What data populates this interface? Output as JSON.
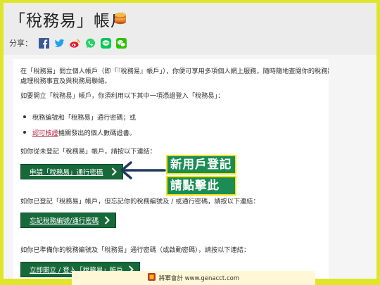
{
  "page": {
    "title": "「稅務易」帳戶"
  },
  "share": {
    "label": "分享：",
    "icons": [
      "facebook-icon",
      "twitter-icon",
      "weibo-icon",
      "whatsapp-icon",
      "line-icon",
      "wechat-icon"
    ]
  },
  "content": {
    "intro_line1": "在「稅務易」開立個人帳戶（即「『稅務易』帳戶」），你便可享用多項個人網上服務，隨時隨地查閱你的稅務狀況、",
    "intro_line2": "處理稅務事宜及與稅務局聯絡。",
    "method_intro": "如要開立「稅務易」帳戶，你須利用以下其中一項憑證登入「稅務易」：",
    "bullet1": "稅務編號和「稅務易」通行密碼；或",
    "bullet2_link": "認可核證",
    "bullet2_rest": "機關發出的個人數碼證書。",
    "section1_text": "如你從未登記「稅務易」帳戶，請按以下連結：",
    "section1_button": "申請「稅務易」通行密碼",
    "section2_text": "如你已登記「稅務易」帳戶，但忘記你的稅務編號及 / 或通行密碼，請按以下連結：",
    "section2_button": "忘記稅務編號/通行密碼",
    "section3_text": "如你已準備你的稅務編號及「稅務易」通行密碼（或啟動密碼），請按以下連結：",
    "section3_button": "立即開立 / 登入「稅務易」帳戶"
  },
  "callout": {
    "line1": "新用戶登記",
    "line2": "請點擊此"
  },
  "footer": {
    "text": "將軍會計 www.genacct.com"
  },
  "colors": {
    "background": "#dfe62a",
    "button": "#17693a",
    "callout": "#1b8d54",
    "link": "#b11e3a"
  }
}
